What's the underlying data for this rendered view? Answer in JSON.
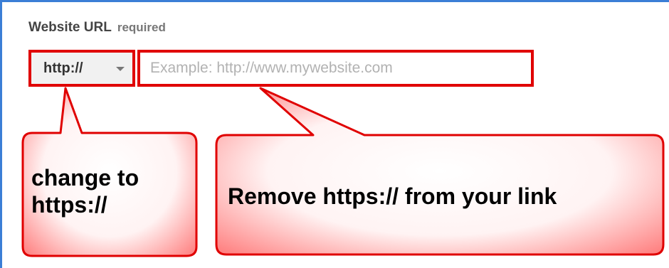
{
  "form": {
    "label": "Website URL",
    "required_label": "required",
    "protocol_value": "http://",
    "url_placeholder": "Example: http://www.mywebsite.com"
  },
  "annotations": {
    "left_line1": "change to",
    "left_line2": "https://",
    "right_text": "Remove https:// from your link"
  },
  "colors": {
    "frame_border": "#3b7ed6",
    "highlight_red": "#e00000",
    "callout_fill": "#ffd4d4"
  }
}
